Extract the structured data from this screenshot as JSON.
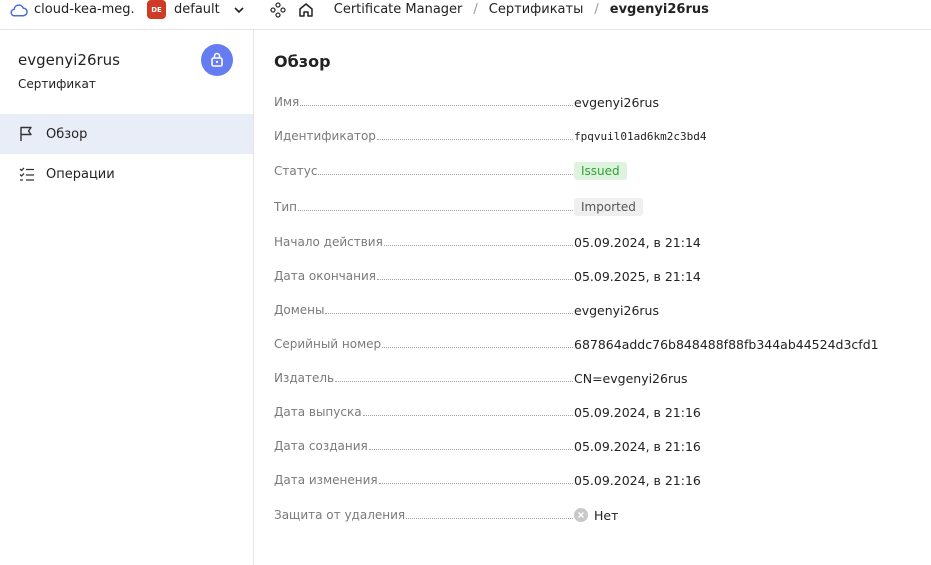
{
  "topbar": {
    "cloud_name": "cloud-kea-meg...",
    "folder_badge": "DE",
    "folder_name": "default",
    "breadcrumbs": [
      "Certificate Manager",
      "Сертификаты",
      "evgenyi26rus"
    ],
    "separator": "/"
  },
  "sidebar": {
    "resource_name": "evgenyi26rus",
    "resource_type": "Сертификат",
    "items": [
      {
        "label": "Обзор",
        "icon": "flag-icon",
        "active": true
      },
      {
        "label": "Операции",
        "icon": "list-checks-icon",
        "active": false
      }
    ]
  },
  "main": {
    "title": "Обзор",
    "props": [
      {
        "label": "Имя",
        "value": "evgenyi26rus"
      },
      {
        "label": "Идентификатор",
        "value": "fpqvuil01ad6km2c3bd4"
      },
      {
        "label": "Статус",
        "value": "Issued"
      },
      {
        "label": "Тип",
        "value": "Imported"
      },
      {
        "label": "Начало действия",
        "value": "05.09.2024, в 21:14"
      },
      {
        "label": "Дата окончания",
        "value": "05.09.2025, в 21:14"
      },
      {
        "label": "Домены",
        "value": "evgenyi26rus"
      },
      {
        "label": "Серийный номер",
        "value": "687864addc76b848488f88fb344ab44524d3cfd1"
      },
      {
        "label": "Издатель",
        "value": "CN=evgenyi26rus"
      },
      {
        "label": "Дата выпуска",
        "value": "05.09.2024, в 21:16"
      },
      {
        "label": "Дата создания",
        "value": "05.09.2024, в 21:16"
      },
      {
        "label": "Дата изменения",
        "value": "05.09.2024, в 21:16"
      },
      {
        "label": "Защита от удаления",
        "value": "Нет"
      }
    ]
  },
  "colors": {
    "accent": "#657df0",
    "folder_badge": "#cf3a24",
    "status_green": "#34a034",
    "active_nav_bg": "#e9edf7"
  }
}
